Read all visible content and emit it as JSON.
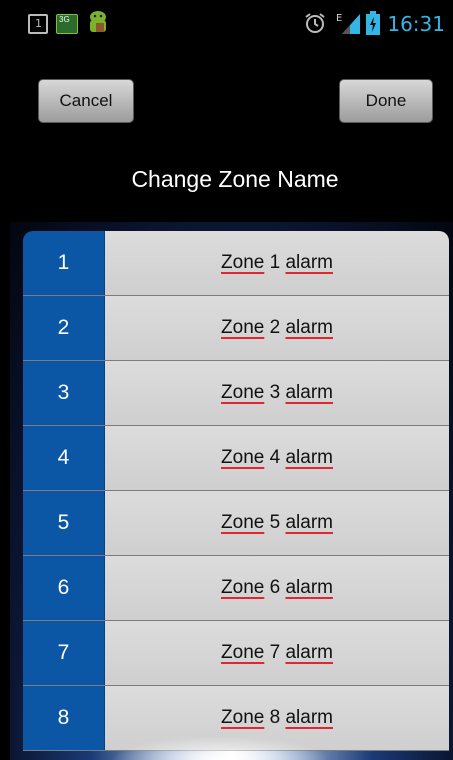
{
  "status_bar": {
    "screen_icon_text": "1",
    "net_badge": "3G",
    "signal_label": "E",
    "time": "16:31",
    "icons": [
      "screenshot-icon",
      "3g-icon",
      "android-icon",
      "alarm-icon",
      "signal-icon",
      "battery-icon"
    ],
    "time_color": "#33b5e5"
  },
  "toolbar": {
    "cancel_label": "Cancel",
    "done_label": "Done"
  },
  "title": "Change Zone Name",
  "zones": [
    {
      "number": "1",
      "prefix": "Zone",
      "index": "1",
      "suffix": "alarm"
    },
    {
      "number": "2",
      "prefix": "Zone",
      "index": "2",
      "suffix": "alarm"
    },
    {
      "number": "3",
      "prefix": "Zone",
      "index": "3",
      "suffix": "alarm"
    },
    {
      "number": "4",
      "prefix": "Zone",
      "index": "4",
      "suffix": "alarm"
    },
    {
      "number": "5",
      "prefix": "Zone",
      "index": "5",
      "suffix": "alarm"
    },
    {
      "number": "6",
      "prefix": "Zone",
      "index": "6",
      "suffix": "alarm"
    },
    {
      "number": "7",
      "prefix": "Zone",
      "index": "7",
      "suffix": "alarm"
    },
    {
      "number": "8",
      "prefix": "Zone",
      "index": "8",
      "suffix": "alarm"
    }
  ],
  "colors": {
    "number_cell": "#0c56a6",
    "name_cell": "#d6d6d6",
    "spellcheck_underline": "#e0262f"
  }
}
